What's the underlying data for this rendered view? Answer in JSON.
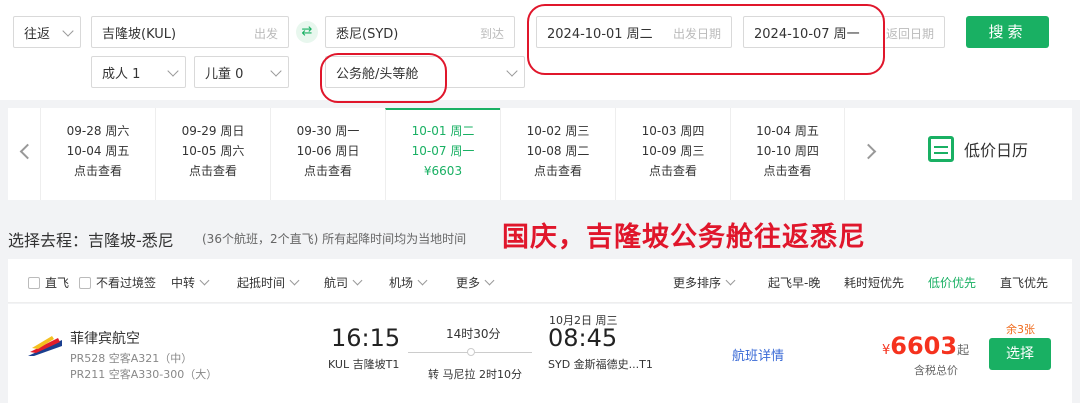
{
  "search": {
    "trip_type": "往返",
    "origin": "吉隆坡(KUL)",
    "origin_placeholder": "出发",
    "destination": "悉尼(SYD)",
    "destination_placeholder": "到达",
    "depart_date": "2024-10-01 周二",
    "depart_date_placeholder": "出发日期",
    "return_date": "2024-10-07 周一",
    "return_date_placeholder": "返回日期",
    "adults": "成人 1",
    "children": "儿童 0",
    "cabin": "公务舱/头等舱",
    "search_label": "搜索"
  },
  "date_strip": {
    "cells": [
      {
        "dep": "09-28 周六",
        "ret": "10-04 周五",
        "info": "点击查看"
      },
      {
        "dep": "09-29 周日",
        "ret": "10-05 周六",
        "info": "点击查看"
      },
      {
        "dep": "09-30 周一",
        "ret": "10-06 周日",
        "info": "点击查看"
      },
      {
        "dep": "10-01 周二",
        "ret": "10-07 周一",
        "info": "¥6603"
      },
      {
        "dep": "10-02 周三",
        "ret": "10-08 周二",
        "info": "点击查看"
      },
      {
        "dep": "10-03 周四",
        "ret": "10-09 周三",
        "info": "点击查看"
      },
      {
        "dep": "10-04 周五",
        "ret": "10-10 周四",
        "info": "点击查看"
      }
    ],
    "calendar_label": "低价日历",
    "active_index": 3
  },
  "heading": {
    "title": "选择去程：吉隆坡-悉尼",
    "subtitle": "(36个航班，2个直飞) 所有起降时间均为当地时间",
    "annotation": "国庆，吉隆坡公务舱往返悉尼"
  },
  "filters": {
    "checkboxes": [
      "直飞",
      "不看过境签"
    ],
    "dropdowns": [
      "中转",
      "起抵时间",
      "航司",
      "机场",
      "更多"
    ],
    "more_sort": "更多排序",
    "sorts": [
      "起飞早-晚",
      "耗时短优先",
      "低价优先",
      "直飞优先"
    ]
  },
  "flight": {
    "airline": "菲律宾航空",
    "flight_1": "PR528 空客A321（中）",
    "flight_2": "PR211 空客A330-300（大）",
    "dep_time": "16:15",
    "dep_airport": "KUL 吉隆坡T1",
    "duration": "14时30分",
    "transfer": "转 马尼拉 2时10分",
    "arr_date": "10月2日 周三",
    "arr_time": "08:45",
    "arr_airport": "SYD 金斯福德史...T1",
    "detail_link": "航班详情",
    "seats_left": "余3张",
    "currency": "¥",
    "price": "6603",
    "price_suffix": "起",
    "tax_note": "含税总价",
    "choose_label": "选择"
  },
  "colors": {
    "brand_green": "#19b063",
    "price_red": "#f5321e",
    "annotation_red": "#e0162b",
    "link_blue": "#3a6ad6"
  }
}
